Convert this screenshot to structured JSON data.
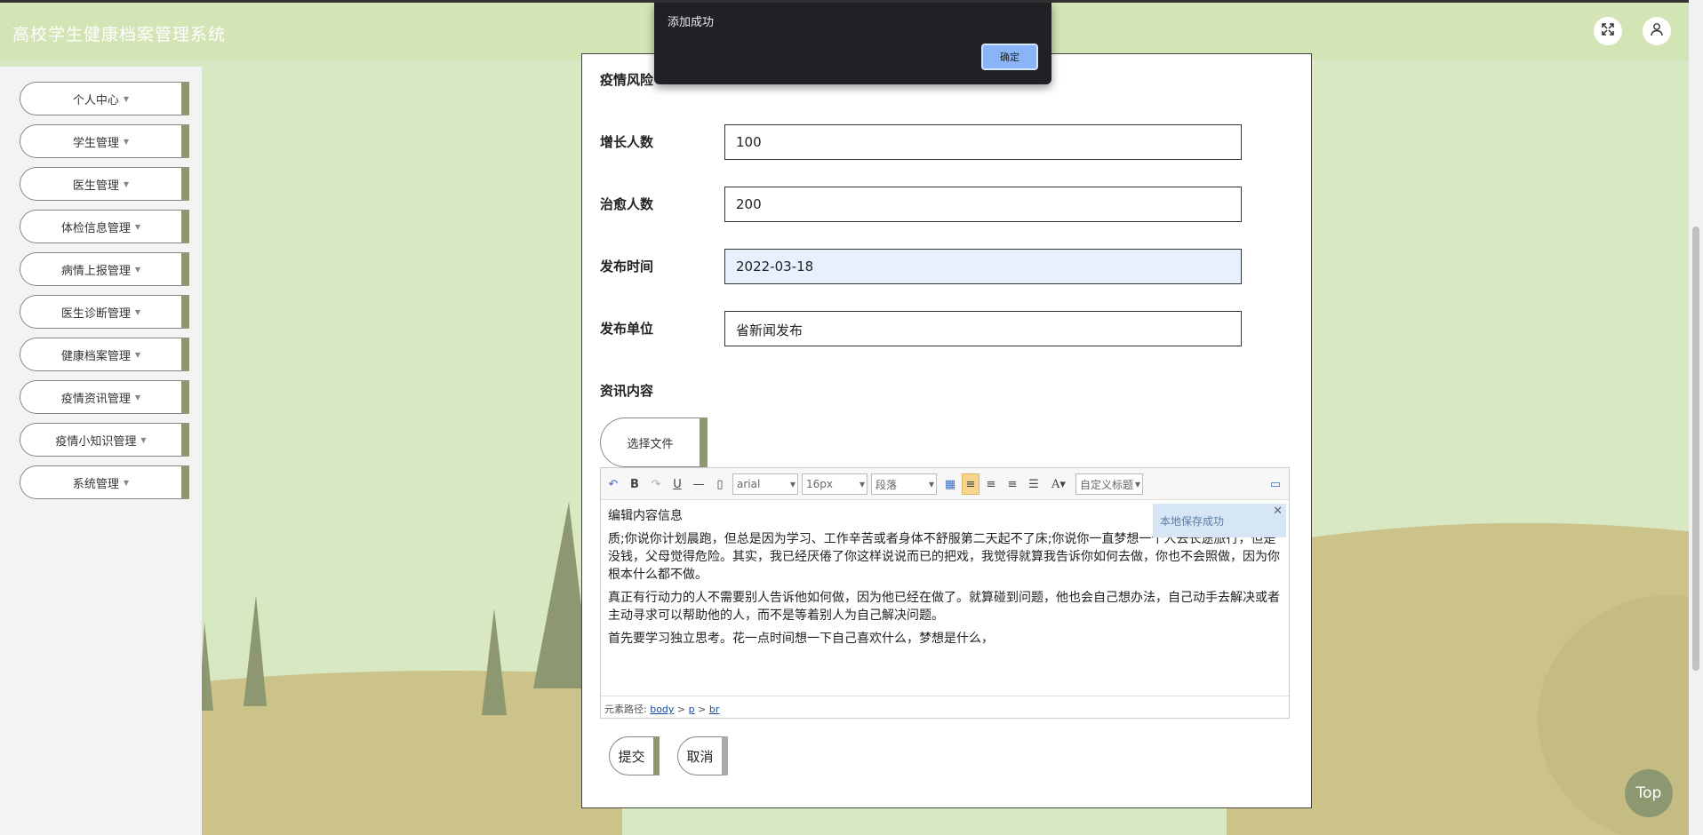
{
  "header": {
    "title": "高校学生健康档案管理系统"
  },
  "icons": {
    "fullscreen": "fullscreen-icon",
    "user": "user-icon"
  },
  "sidebar": {
    "items": [
      {
        "label": "个人中心"
      },
      {
        "label": "学生管理"
      },
      {
        "label": "医生管理"
      },
      {
        "label": "体检信息管理"
      },
      {
        "label": "病情上报管理"
      },
      {
        "label": "医生诊断管理"
      },
      {
        "label": "健康档案管理"
      },
      {
        "label": "疫情资讯管理"
      },
      {
        "label": "疫情小知识管理"
      },
      {
        "label": "系统管理"
      }
    ]
  },
  "form": {
    "risk_label": "疫情风险",
    "increase_label": "增长人数",
    "increase_value": "100",
    "cured_label": "治愈人数",
    "cured_value": "200",
    "date_label": "发布时间",
    "date_value": "2022-03-18",
    "unit_label": "发布单位",
    "unit_value": "省新闻发布",
    "content_label": "资讯内容",
    "file_button": "选择文件",
    "submit": "提交",
    "cancel": "取消"
  },
  "editor": {
    "font": "arial",
    "size": "16px",
    "paragraph": "段落",
    "custom_title": "自定义标题",
    "notice": "本地保存成功",
    "paragraphs": [
      "编辑内容信息",
      "质;你说你计划晨跑，但总是因为学习、工作辛苦或者身体不舒服第二天起不了床;你说你一直梦想一个人去长途旅行，但是没钱，父母觉得危险。其实，我已经厌倦了你这样说说而已的把戏，我觉得就算我告诉你如何去做，你也不会照做，因为你根本什么都不做。",
      "真正有行动力的人不需要别人告诉他如何做，因为他已经在做了。就算碰到问题，他也会自己想办法，自己动手去解决或者主动寻求可以帮助他的人，而不是等着别人为自己解决问题。",
      "首先要学习独立思考。花一点时间想一下自己喜欢什么，梦想是什么，"
    ],
    "path_label": "元素路径:",
    "path": [
      "body",
      "p",
      "br"
    ]
  },
  "dialog": {
    "message": "添加成功",
    "ok": "确定"
  },
  "top_button": "Top",
  "colors": {
    "accent": "#8d9770",
    "header": "#d3e4b5"
  }
}
